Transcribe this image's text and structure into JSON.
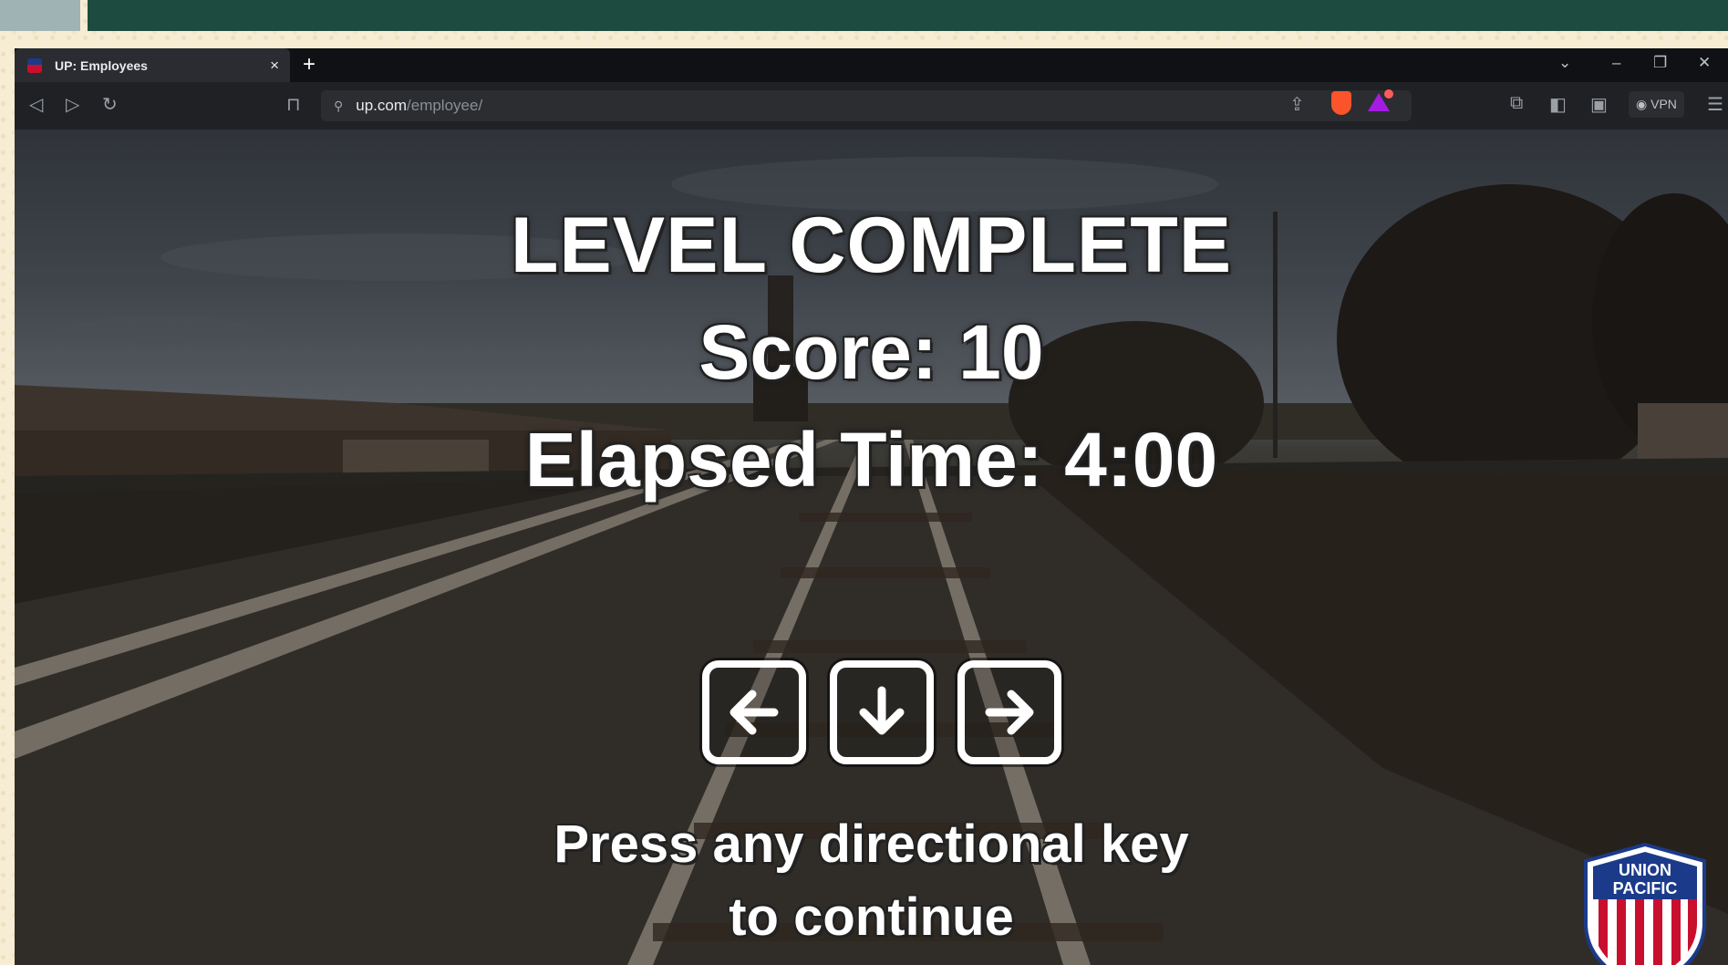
{
  "browser": {
    "tab_title": "UP: Employees",
    "tab_close": "×",
    "new_tab": "+",
    "url_host": "up.com",
    "url_path": "/employee/",
    "vpn_label": "VPN"
  },
  "game": {
    "title": "LEVEL COMPLETE",
    "score": "Score: 10",
    "elapsed_time": "Elapsed Time: 4:00",
    "prompt_line1": "Press any directional key",
    "prompt_line2": "to continue",
    "keys": [
      "left-arrow-icon",
      "down-arrow-icon",
      "right-arrow-icon"
    ]
  },
  "logo": {
    "line1": "UNION",
    "line2": "PACIFIC",
    "colors": {
      "blue": "#1b3a8a",
      "red": "#c8102e",
      "white": "#ffffff"
    }
  },
  "colors": {
    "top_strip_left": "#9fb3b5",
    "top_strip_right": "#1e4b3f",
    "tabbar": "#0f1114",
    "toolbar": "#202124"
  }
}
